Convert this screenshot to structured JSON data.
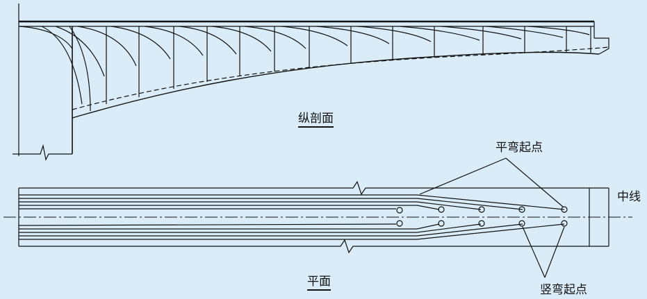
{
  "labels": {
    "longitudinal_section": "纵剖面",
    "horizontal_bend_start": "平弯起点",
    "centerline": "中线",
    "plan": "平面",
    "vertical_bend_start": "竖弯起点"
  },
  "colors": {
    "background": "#d9ecf7",
    "line": "#111111"
  }
}
